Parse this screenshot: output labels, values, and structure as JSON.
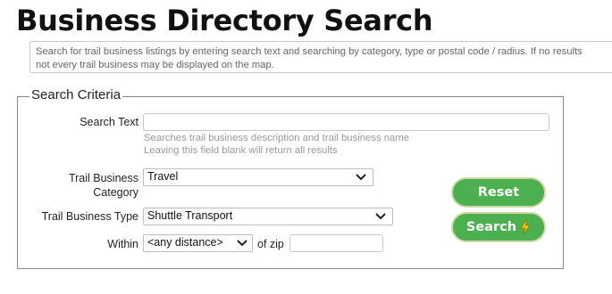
{
  "page": {
    "title": "Business Directory Search",
    "info_line1": "Search for trail business listings by entering search text and searching by category, type or postal code / radius. If no results",
    "info_line2": "not every trail business may be displayed on the map."
  },
  "criteria": {
    "legend": "Search Criteria",
    "search_text": {
      "label": "Search Text",
      "value": "",
      "hint1": "Searches trail business description and trail business name",
      "hint2": "Leaving this field blank will return all results"
    },
    "category": {
      "label1": "Trail Business",
      "label2": "Category",
      "value": "Travel"
    },
    "type": {
      "label": "Trail Business Type",
      "value": "Shuttle Transport"
    },
    "within": {
      "label": "Within",
      "distance": "<any distance>",
      "of_zip": "of zip",
      "zip_value": ""
    }
  },
  "buttons": {
    "reset": "Reset",
    "search": "Search"
  },
  "colors": {
    "button_bg": "#4caf50",
    "bolt": "#f5c400"
  },
  "icons": [
    "chevron-down-icon",
    "lightning-bolt-icon"
  ]
}
